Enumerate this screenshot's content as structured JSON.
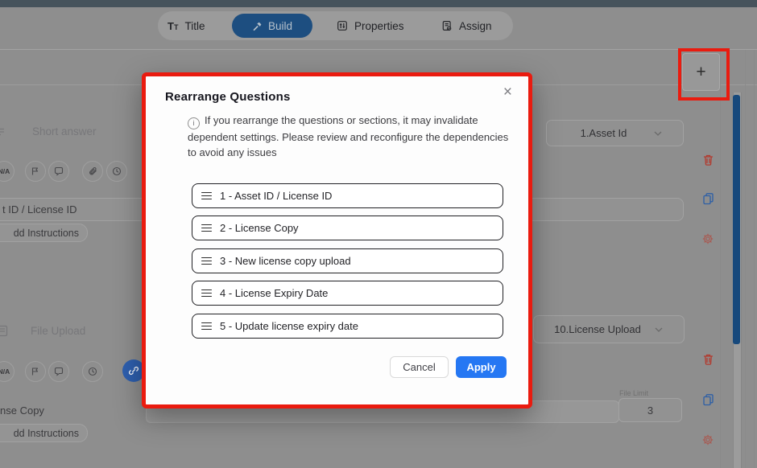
{
  "tabs": {
    "title": "Title",
    "build": "Build",
    "properties": "Properties",
    "assign": "Assign"
  },
  "toolbar": {
    "add_label": "+"
  },
  "modal": {
    "title": "Rearrange Questions",
    "close_glyph": "×",
    "warning": "If you rearrange the questions or sections, it may invalidate dependent settings. Please review and reconfigure the dependencies to avoid any issues",
    "items": [
      "1 - Asset ID / License ID",
      "2 - License Copy",
      "3 - New license copy upload",
      "4 - License Expiry Date",
      "5 - Update license expiry date"
    ],
    "cancel_label": "Cancel",
    "apply_label": "Apply"
  },
  "q1": {
    "type_label": "Short answer",
    "na_label": "N/A",
    "title_text": "t ID / License ID",
    "instructions_label": "dd Instructions",
    "dependency_label": "1.Asset Id"
  },
  "q2": {
    "type_label": "File Upload",
    "na_label": "N/A",
    "title_text": "nse Copy",
    "instructions_label": "dd Instructions",
    "dependency_label": "10.License Upload",
    "file_limit_label": "File Limit",
    "file_limit_value": "3"
  },
  "colors": {
    "annotation_red": "#ea1b0f",
    "apply_blue": "#2577f3",
    "build_tab_blue": "#1d4e80",
    "scrollbar_blue": "#17497c"
  }
}
